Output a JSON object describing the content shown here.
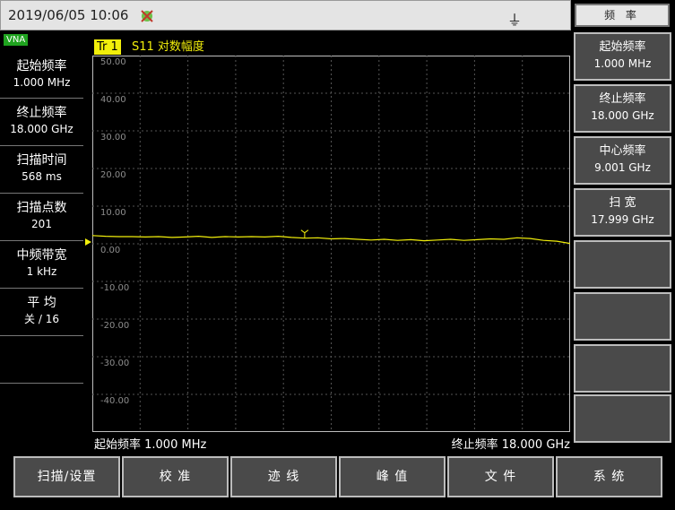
{
  "status_bar": {
    "datetime": "2019/06/05 10:06",
    "icon": "plug-icon"
  },
  "menu": {
    "header": "频 率"
  },
  "vna_badge": "VNA",
  "left_panel": [
    {
      "label": "起始频率",
      "value": "1.000 MHz"
    },
    {
      "label": "终止频率",
      "value": "18.000 GHz"
    },
    {
      "label": "扫描时间",
      "value": "568 ms"
    },
    {
      "label": "扫描点数",
      "value": "201"
    },
    {
      "label": "中频带宽",
      "value": "1 kHz"
    },
    {
      "label": "平 均",
      "value": "关 / 16"
    }
  ],
  "trace": {
    "tag": "Tr 1",
    "desc": "S11 对数幅度",
    "color": "#f2ef0b"
  },
  "chart_data": {
    "type": "line",
    "yticks": [
      "50.00",
      "40.00",
      "30.00",
      "20.00",
      "10.00",
      "0.00",
      "-10.00",
      "-20.00",
      "-30.00",
      "-40.00"
    ],
    "ylim": [
      -50,
      50
    ],
    "xlim": [
      0.001,
      18.0
    ],
    "x_unit": "GHz",
    "grid": true,
    "series": [
      {
        "x": [
          0.001,
          0.5,
          1.0,
          1.5,
          2.0,
          2.5,
          3.0,
          3.5,
          4.0,
          4.5,
          5.0,
          5.5,
          6.0,
          6.5,
          7.0,
          7.5,
          8.0,
          8.5,
          9.0,
          9.5,
          10.0,
          10.5,
          11.0,
          11.5,
          12.0,
          12.5,
          13.0,
          13.5,
          14.0,
          14.5,
          15.0,
          15.5,
          16.0,
          16.5,
          17.0,
          17.5,
          18.0
        ],
        "y": [
          2.2,
          2.0,
          1.9,
          1.9,
          1.8,
          1.9,
          1.7,
          1.8,
          2.0,
          1.7,
          1.9,
          1.8,
          1.9,
          1.8,
          2.0,
          1.7,
          1.5,
          1.6,
          1.3,
          1.4,
          1.2,
          1.0,
          1.2,
          0.9,
          1.1,
          0.8,
          1.0,
          1.2,
          0.9,
          1.1,
          1.3,
          1.2,
          1.6,
          1.4,
          0.9,
          0.7,
          0.1
        ]
      }
    ],
    "marker_x": 8.0
  },
  "footer": {
    "start": "起始频率  1.000 MHz",
    "stop": "终止频率  18.000 GHz"
  },
  "softkeys": [
    {
      "label": "起始频率",
      "value": "1.000 MHz"
    },
    {
      "label": "终止频率",
      "value": "18.000 GHz"
    },
    {
      "label": "中心频率",
      "value": "9.001 GHz"
    },
    {
      "label": "扫 宽",
      "value": "17.999 GHz"
    },
    {
      "label": "",
      "value": ""
    },
    {
      "label": "",
      "value": ""
    },
    {
      "label": "",
      "value": ""
    },
    {
      "label": "",
      "value": ""
    }
  ],
  "bottom_buttons": [
    "扫描/设置",
    "校 准",
    "迹 线",
    "峰 值",
    "文 件",
    "系 统"
  ]
}
